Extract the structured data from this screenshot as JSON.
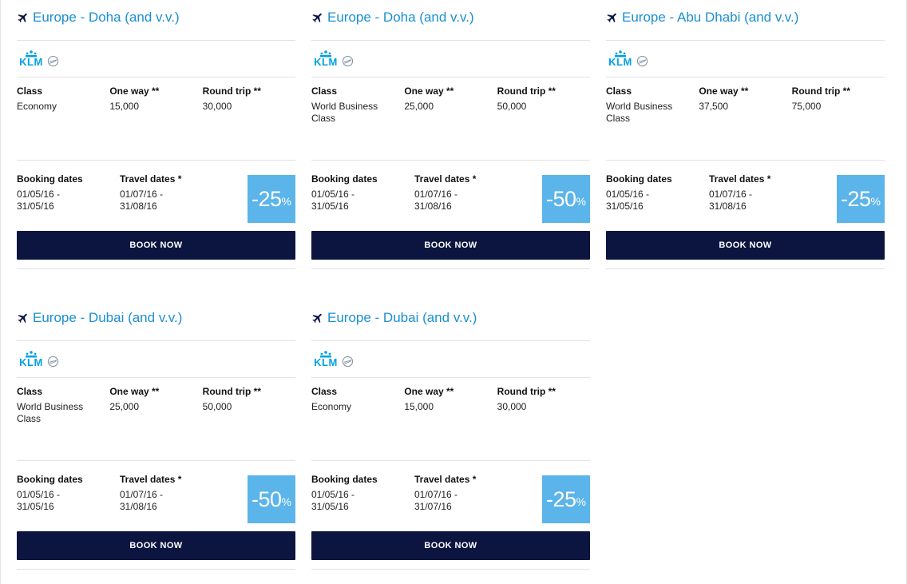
{
  "cards": [
    {
      "title": "Europe - Doha (and v.v.)",
      "logo_text": "KLM",
      "class_label": "Class",
      "class_value": "Economy",
      "one_way_label": "One way **",
      "one_way_value": "15,000",
      "round_trip_label": "Round trip **",
      "round_trip_value": "30,000",
      "booking_label": "Booking dates",
      "booking_from": "01/05/16 -",
      "booking_to": "31/05/16",
      "travel_label": "Travel dates *",
      "travel_from": "01/07/16 -",
      "travel_to": "31/08/16",
      "discount": "-25",
      "discount_unit": "%",
      "button": "BOOK NOW"
    },
    {
      "title": "Europe - Doha (and v.v.)",
      "logo_text": "KLM",
      "class_label": "Class",
      "class_value": "World Business Class",
      "one_way_label": "One way **",
      "one_way_value": "25,000",
      "round_trip_label": "Round trip **",
      "round_trip_value": "50,000",
      "booking_label": "Booking dates",
      "booking_from": "01/05/16 -",
      "booking_to": "31/05/16",
      "travel_label": "Travel dates *",
      "travel_from": "01/07/16 -",
      "travel_to": "31/08/16",
      "discount": "-50",
      "discount_unit": "%",
      "button": "BOOK NOW"
    },
    {
      "title": "Europe - Abu Dhabi (and v.v.)",
      "logo_text": "KLM",
      "class_label": "Class",
      "class_value": "World Business Class",
      "one_way_label": "One way **",
      "one_way_value": "37,500",
      "round_trip_label": "Round trip **",
      "round_trip_value": "75,000",
      "booking_label": "Booking dates",
      "booking_from": "01/05/16 -",
      "booking_to": "31/05/16",
      "travel_label": "Travel dates *",
      "travel_from": "01/07/16 -",
      "travel_to": "31/08/16",
      "discount": "-25",
      "discount_unit": "%",
      "button": "BOOK NOW"
    },
    {
      "title": "Europe - Dubai (and v.v.)",
      "logo_text": "KLM",
      "class_label": "Class",
      "class_value": "World Business Class",
      "one_way_label": "One way **",
      "one_way_value": "25,000",
      "round_trip_label": "Round trip **",
      "round_trip_value": "50,000",
      "booking_label": "Booking dates",
      "booking_from": "01/05/16 -",
      "booking_to": "31/05/16",
      "travel_label": "Travel dates *",
      "travel_from": "01/07/16 -",
      "travel_to": "31/08/16",
      "discount": "-50",
      "discount_unit": "%",
      "button": "BOOK NOW"
    },
    {
      "title": "Europe - Dubai (and v.v.)",
      "logo_text": "KLM",
      "class_label": "Class",
      "class_value": "Economy",
      "one_way_label": "One way **",
      "one_way_value": "15,000",
      "round_trip_label": "Round trip **",
      "round_trip_value": "30,000",
      "booking_label": "Booking dates",
      "booking_from": "01/05/16 -",
      "booking_to": "31/05/16",
      "travel_label": "Travel dates *",
      "travel_from": "01/07/16 -",
      "travel_to": "31/07/16",
      "discount": "-25",
      "discount_unit": "%",
      "button": "BOOK NOW"
    }
  ],
  "colors": {
    "title_blue": "#1b8fd1",
    "klm_blue": "#00a1e4",
    "badge_blue": "#5bb4ea",
    "button_navy": "#0b1540"
  },
  "icons": {
    "route": "plane-icon",
    "partner": "skyteam-icon"
  }
}
